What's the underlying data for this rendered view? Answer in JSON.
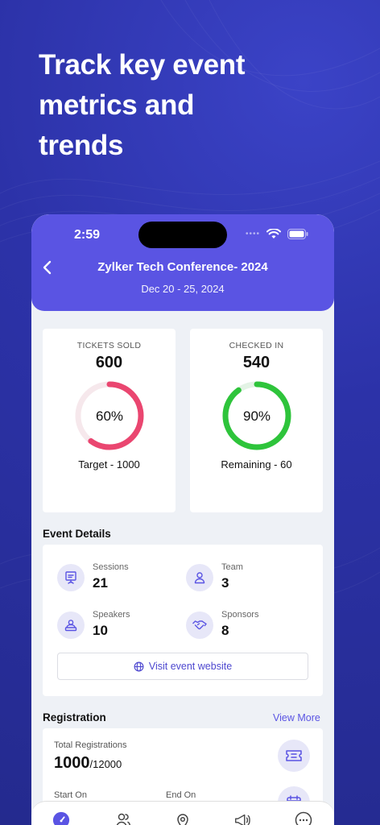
{
  "headline": "Track key event\nmetrics and\ntrends",
  "status": {
    "time": "2:59",
    "signal_dots": "••••"
  },
  "event": {
    "title": "Zylker Tech Conference- 2024",
    "dates": "Dec 20 - 25, 2024"
  },
  "tickets": {
    "label": "TICKETS SOLD",
    "value": "600",
    "percent": "60%",
    "progress": 0.6,
    "sub": "Target - 1000",
    "color": "#ea4670",
    "track": "#f6e8ec"
  },
  "checkin": {
    "label": "CHECKED IN",
    "value": "540",
    "percent": "90%",
    "progress": 0.9,
    "sub": "Remaining - 60",
    "color": "#2ec43b",
    "track": "#e3f3e5"
  },
  "details": {
    "title": "Event Details",
    "items": [
      {
        "label": "Sessions",
        "value": "21",
        "icon": "presentation-icon"
      },
      {
        "label": "Team",
        "value": "3",
        "icon": "person-icon"
      },
      {
        "label": "Speakers",
        "value": "10",
        "icon": "speaker-icon"
      },
      {
        "label": "Sponsors",
        "value": "8",
        "icon": "handshake-icon"
      }
    ],
    "visit_label": "Visit event website"
  },
  "registration": {
    "title": "Registration",
    "view_more": "View More",
    "total_label": "Total Registrations",
    "total_value": "1000",
    "total_cap": "/12000",
    "start_label": "Start On",
    "end_label": "End On"
  },
  "colors": {
    "accent": "#5a54e3",
    "background": "#2c32a8"
  }
}
